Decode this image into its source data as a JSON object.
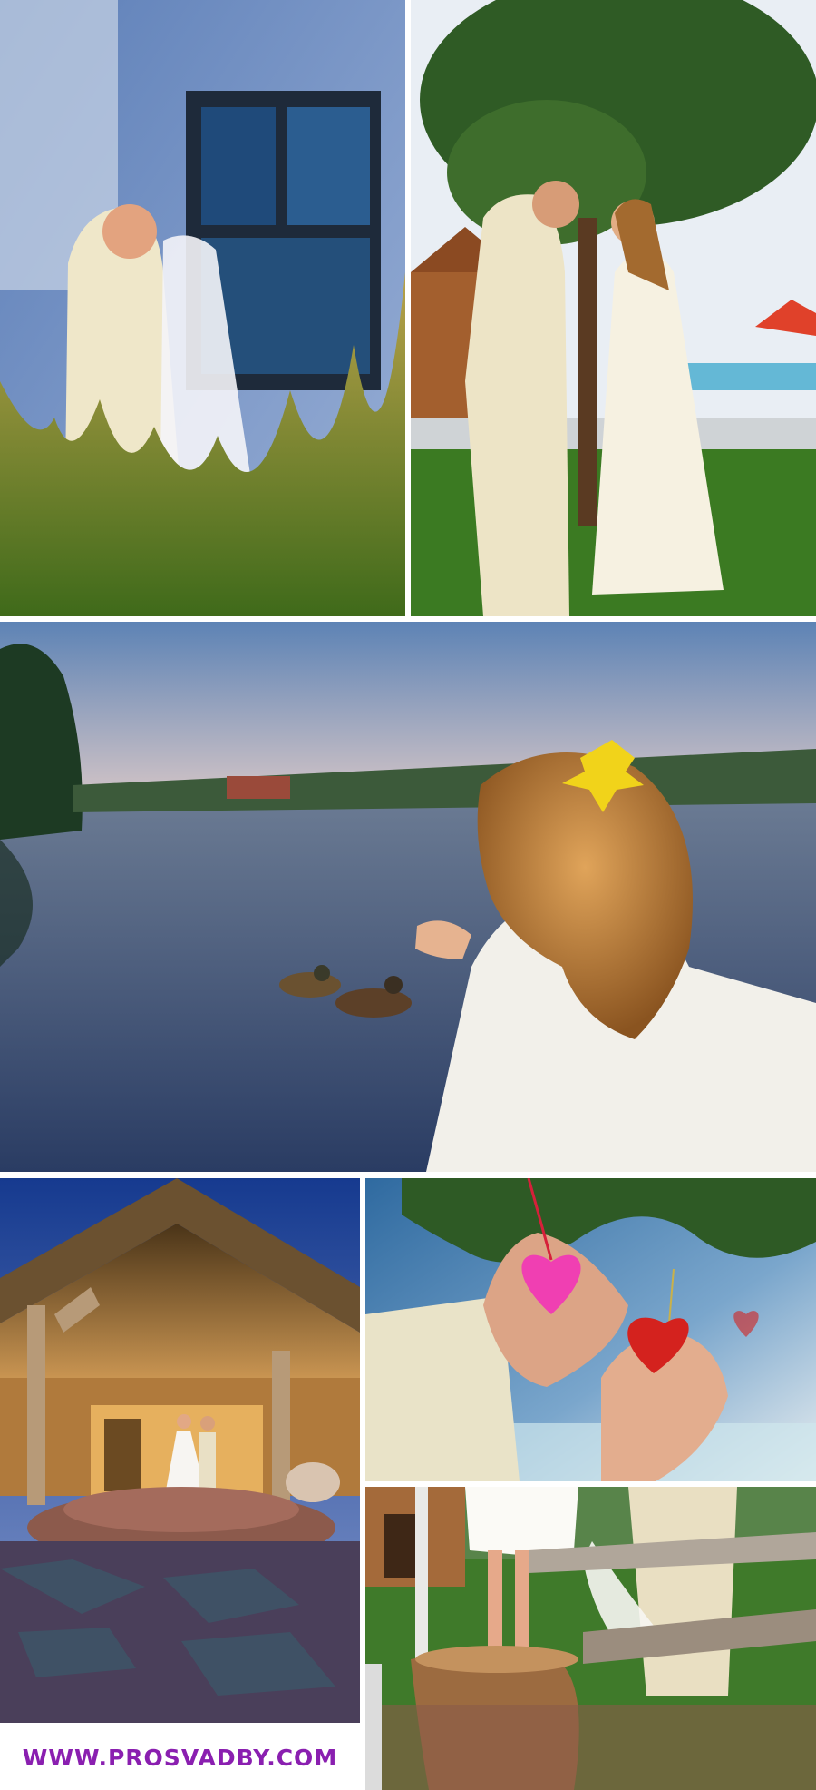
{
  "footer": {
    "website": "WWW.PROSVADBY.COM",
    "link_color": "#8a1fb0"
  },
  "photos": [
    {
      "id": "couple-by-window",
      "layout": "top-left"
    },
    {
      "id": "kiss-under-tree",
      "layout": "top-right"
    },
    {
      "id": "bride-by-lake-with-ducks",
      "layout": "full-width"
    },
    {
      "id": "dance-at-log-house",
      "layout": "bottom-left"
    },
    {
      "id": "hands-with-hearts",
      "layout": "bottom-right-upper"
    },
    {
      "id": "legs-on-bench",
      "layout": "bottom-right-lower"
    }
  ]
}
